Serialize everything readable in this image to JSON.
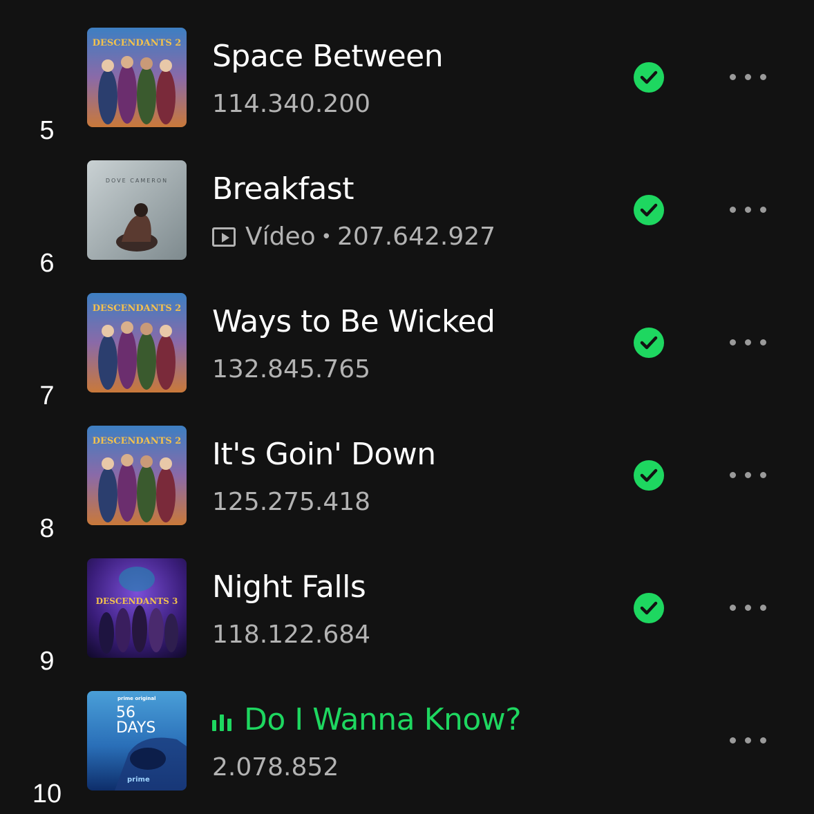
{
  "colors": {
    "background": "#121212",
    "accent_green": "#1ed760",
    "secondary_text": "#b3b3b3"
  },
  "tracks": [
    {
      "rank": "5",
      "title": "Space Between",
      "plays": "114.340.200",
      "is_video": false,
      "is_playing": false,
      "saved": true,
      "cover": "descendants-2",
      "cover_text": "DESCENDANTS 2"
    },
    {
      "rank": "6",
      "title": "Breakfast",
      "video_label": "Vídeo",
      "separator": "•",
      "plays": "207.642.927",
      "is_video": true,
      "is_playing": false,
      "saved": true,
      "cover": "dove-cameron",
      "cover_text": "DOVE CAMERON"
    },
    {
      "rank": "7",
      "title": "Ways to Be Wicked",
      "plays": "132.845.765",
      "is_video": false,
      "is_playing": false,
      "saved": true,
      "cover": "descendants-2",
      "cover_text": "DESCENDANTS 2"
    },
    {
      "rank": "8",
      "title": "It's Goin' Down",
      "plays": "125.275.418",
      "is_video": false,
      "is_playing": false,
      "saved": true,
      "cover": "descendants-2",
      "cover_text": "DESCENDANTS 2"
    },
    {
      "rank": "9",
      "title": "Night Falls",
      "plays": "118.122.684",
      "is_video": false,
      "is_playing": false,
      "saved": true,
      "cover": "descendants-3",
      "cover_text": "DESCENDANTS 3"
    },
    {
      "rank": "10",
      "title": "Do I Wanna Know?",
      "plays": "2.078.852",
      "is_video": false,
      "is_playing": true,
      "saved": false,
      "cover": "56-days",
      "cover_text_top": "prime original",
      "cover_text_title_1": "56",
      "cover_text_title_2": "DAYS",
      "cover_text_bottom": "prime"
    }
  ],
  "icons": {
    "saved": "check-circle-icon",
    "more": "more-options-icon",
    "video": "video-icon",
    "playing": "equalizer-icon"
  }
}
